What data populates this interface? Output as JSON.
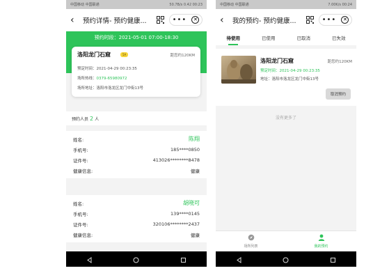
{
  "left": {
    "status_left": "中国移动 中国联通",
    "status_right": "50.7B/s 0.42 00:23",
    "title": "预约详情- 预约健康...",
    "period": "预约时段：2021-05-01 07:00-18:30",
    "venue": {
      "name": "洛阳龙门石窟",
      "badge": "5A",
      "distance": "距您约120KM",
      "book_time_label": "预定时间：",
      "book_time": "2021-04-29 00:23:35",
      "phone_label": "场所热线：",
      "phone": "0379-65980972",
      "address_label": "场所地址：",
      "address": "洛阳市洛龙区龙门中街13号"
    },
    "people_label": "预约人员",
    "people_count": "2",
    "people_unit": "人",
    "persons": [
      {
        "name_label": "姓名:",
        "name": "陈翔",
        "phone_label": "手机号:",
        "phone": "185****0850",
        "id_label": "证件号:",
        "id": "413026********8478",
        "health_label": "健康信息:",
        "health": "健康"
      },
      {
        "name_label": "姓名:",
        "name": "胡晓可",
        "phone_label": "手机号:",
        "phone": "139****0145",
        "id_label": "证件号:",
        "id": "320106********2437",
        "health_label": "健康信息:",
        "health": "健康"
      }
    ]
  },
  "right": {
    "status_left": "中国移动 中国联通",
    "status_right": "7.00K/s 00:24",
    "title": "我的预约- 预约健康...",
    "tabs": [
      "待使用",
      "已使用",
      "已取消",
      "已失效"
    ],
    "booking": {
      "name": "洛阳龙门石窟",
      "distance": "距您约120KM",
      "time_label": "预定时间：",
      "time": "2021-04-29 00:23:35",
      "address_label": "地址：",
      "address": "洛阳市洛龙区龙门中街13号",
      "cancel_label": "取消预约"
    },
    "no_more": "没有更多了",
    "bottom_tabs": [
      "场所列表",
      "我的预约"
    ]
  },
  "colors": {
    "accent": "#2ec45a",
    "badge": "#f5d43a"
  }
}
